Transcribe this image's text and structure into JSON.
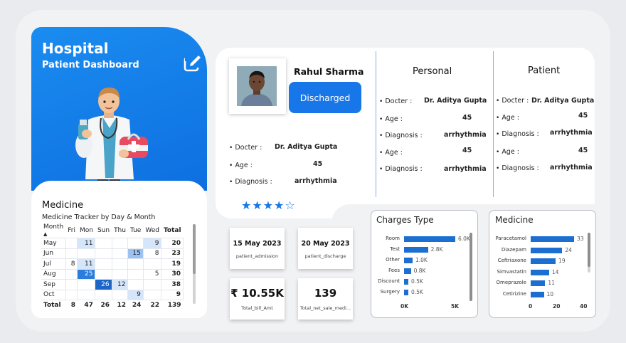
{
  "header": {
    "title": "Hospital",
    "subtitle": "Patient Dashboard",
    "edit_icon": "edit-icon"
  },
  "tracker": {
    "title": "Medicine",
    "subtitle": "Medicine Tracker by Day & Month",
    "columns": [
      "Month",
      "Fri",
      "Mon",
      "Sun",
      "Thu",
      "Tue",
      "Wed",
      "Total"
    ],
    "rows": [
      {
        "month": "May",
        "cells": [
          "",
          "11",
          "",
          "",
          "",
          "9"
        ],
        "total": "20"
      },
      {
        "month": "Jun",
        "cells": [
          "",
          "",
          "",
          "",
          "15",
          "8"
        ],
        "total": "23"
      },
      {
        "month": "Jul",
        "cells": [
          "8",
          "11",
          "",
          "",
          "",
          ""
        ],
        "total": "19"
      },
      {
        "month": "Aug",
        "cells": [
          "",
          "25",
          "",
          "",
          "",
          "5"
        ],
        "total": "30"
      },
      {
        "month": "Sep",
        "cells": [
          "",
          "",
          "26",
          "12",
          "",
          ""
        ],
        "total": "38"
      },
      {
        "month": "Oct",
        "cells": [
          "",
          "",
          "",
          "",
          "9",
          ""
        ],
        "total": "9"
      }
    ],
    "total_row": {
      "label": "Total",
      "cells": [
        "8",
        "47",
        "26",
        "12",
        "24",
        "22"
      ],
      "total": "139"
    }
  },
  "patient": {
    "name": "Rahul Sharma",
    "status": "Discharged",
    "rating_stars": "★★★★☆",
    "rating": 4,
    "fields": [
      {
        "label": "Docter :",
        "value": "Dr. Aditya Gupta"
      },
      {
        "label": "Age :",
        "value": "45"
      },
      {
        "label": "Diagnosis :",
        "value": "arrhythmia"
      }
    ]
  },
  "personal": {
    "title": "Personal",
    "fields": [
      {
        "label": "Docter :",
        "value": "Dr. Aditya Gupta"
      },
      {
        "label": "Age :",
        "value": "45"
      },
      {
        "label": "Diagnosis :",
        "value": "arrhythmia"
      },
      {
        "label": "Age :",
        "value": "45"
      },
      {
        "label": "Diagnosis :",
        "value": "arrhythmia"
      }
    ]
  },
  "patient_panel": {
    "title": "Patient",
    "fields": [
      {
        "label": "Docter :",
        "value": "Dr. Aditya Gupta"
      },
      {
        "label": "Age :",
        "value": "45"
      },
      {
        "label": "Diagnosis :",
        "value": "arrhythmia"
      },
      {
        "label": "Age :",
        "value": "45"
      },
      {
        "label": "Diagnosis :",
        "value": "arrhythmia"
      }
    ]
  },
  "kpis": [
    {
      "value": "15 May 2023",
      "label": "patient_admission"
    },
    {
      "value": "20 May 2023",
      "label": "patient_discharge"
    },
    {
      "value": "₹ 10.55K",
      "label": "Total_bill_Amt"
    },
    {
      "value": "139",
      "label": "Total_net_sale_medi..."
    }
  ],
  "charges_chart": {
    "title": "Charges Type",
    "axis_ticks": [
      "0K",
      "5K"
    ]
  },
  "medicine_chart": {
    "title": "Medicine",
    "axis_ticks": [
      "0",
      "20",
      "40"
    ]
  },
  "colors": {
    "accent": "#1877e8",
    "bar": "#1c6fd1",
    "header_gradient_start": "#1a8cf0"
  },
  "chart_data": [
    {
      "type": "bar",
      "orientation": "horizontal",
      "title": "Charges Type",
      "categories": [
        "Room",
        "Test",
        "Other",
        "Fees",
        "Discount",
        "Surgery"
      ],
      "values": [
        6000,
        2800,
        1000,
        800,
        500,
        500
      ],
      "labels": [
        "6.0K",
        "2.8K",
        "1.0K",
        "0.8K",
        "0.5K",
        "0.5K"
      ],
      "xlim": [
        0,
        6000
      ]
    },
    {
      "type": "bar",
      "orientation": "horizontal",
      "title": "Medicine",
      "categories": [
        "Paracetamol",
        "Diazepam",
        "Ceftriaxone",
        "Simvastatin",
        "Omeprazole",
        "Cetirizine"
      ],
      "values": [
        33,
        24,
        19,
        14,
        11,
        10
      ],
      "labels": [
        "33",
        "24",
        "19",
        "14",
        "11",
        "10"
      ],
      "xlim": [
        0,
        40
      ]
    }
  ]
}
